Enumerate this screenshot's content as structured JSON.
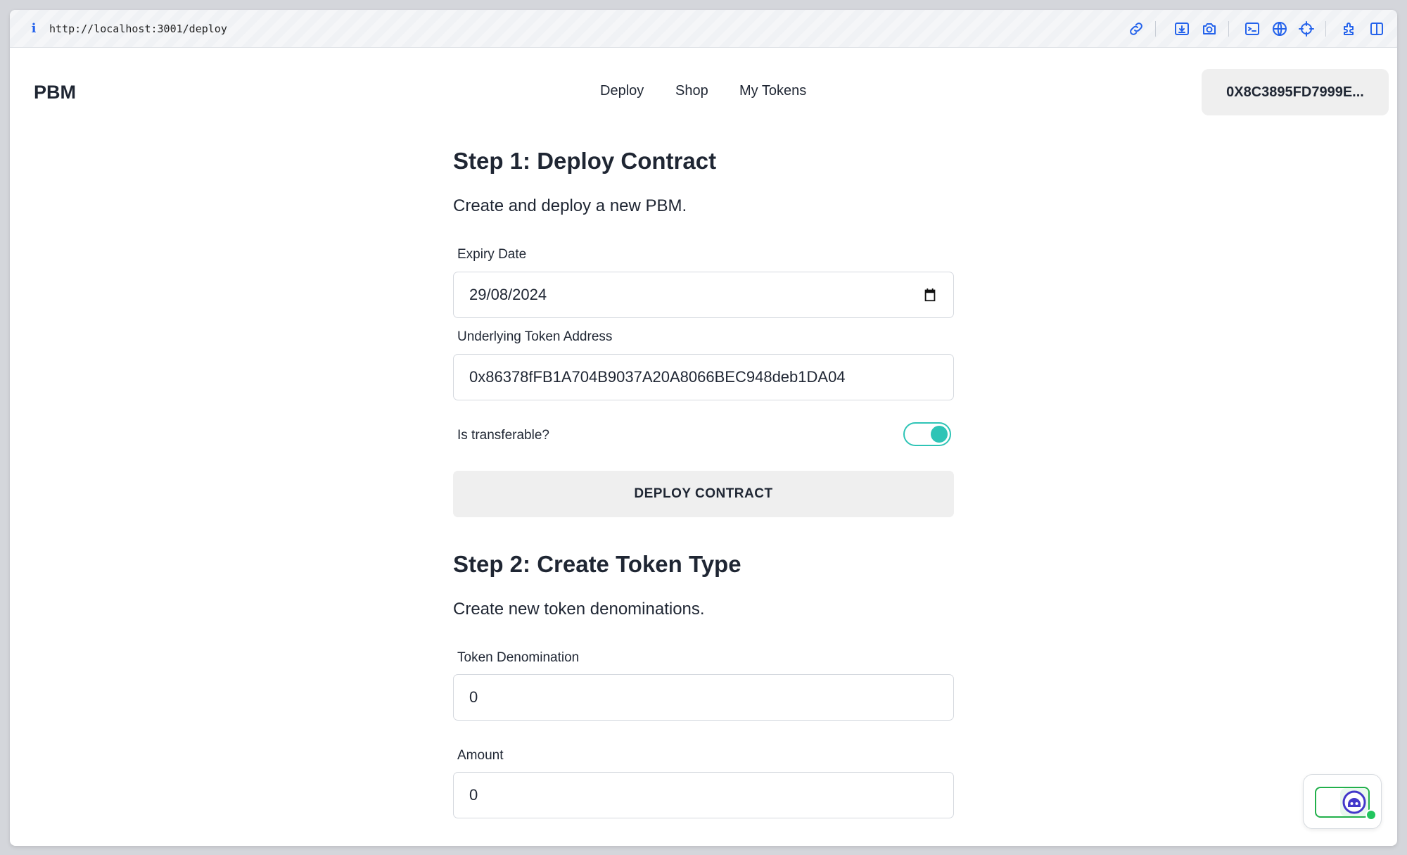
{
  "browser": {
    "url": "http://localhost:3001/deploy",
    "icons": [
      "info-icon",
      "link-icon",
      "download-icon",
      "camera-icon",
      "terminal-icon",
      "globe-icon",
      "crosshair-icon",
      "extensions-icon",
      "split-view-icon"
    ]
  },
  "nav": {
    "brand": "PBM",
    "links": [
      "Deploy",
      "Shop",
      "My Tokens"
    ],
    "wallet": "0X8C3895FD7999E..."
  },
  "step1": {
    "title": "Step 1: Deploy Contract",
    "subtitle": "Create and deploy a new PBM.",
    "expiry_label": "Expiry Date",
    "expiry_value": "29/08/2024",
    "token_address_label": "Underlying Token Address",
    "token_address_value": "0x86378fFB1A704B9037A20A8066BEC948deb1DA04",
    "transferable_label": "Is transferable?",
    "transferable": true,
    "deploy_button": "DEPLOY CONTRACT"
  },
  "step2": {
    "title": "Step 2: Create Token Type",
    "subtitle": "Create new token denominations.",
    "denomination_label": "Token Denomination",
    "denomination_value": "0",
    "amount_label": "Amount",
    "amount_value": "0"
  },
  "colors": {
    "accent": "#2ec4b6",
    "browser_icon": "#2563eb",
    "widget_green": "#22c55e"
  }
}
